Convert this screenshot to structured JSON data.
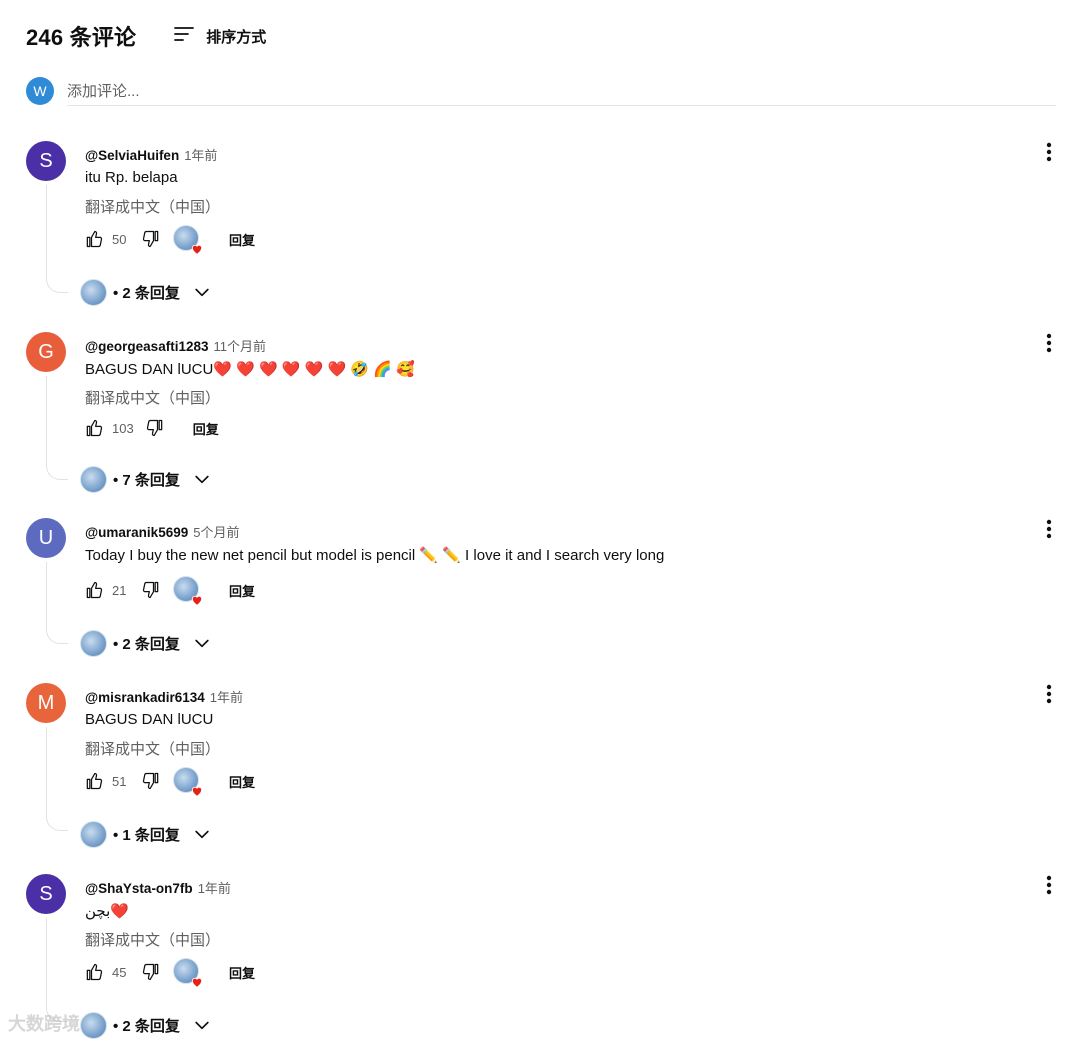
{
  "header": {
    "count": "246 条评论",
    "sort_label": "排序方式"
  },
  "add_comment": {
    "avatar_letter": "W",
    "placeholder": "添加评论..."
  },
  "comments": [
    {
      "letter": "S",
      "avatar_color": "#4a2fa6",
      "author": "@SelviaHuifen",
      "time": "1年前",
      "text": "itu  Rp. belapa",
      "translate": "翻译成中文（中国）",
      "likes": "50",
      "reply": "回复",
      "replies": "• 2 条回复"
    },
    {
      "letter": "G",
      "avatar_color": "#e85d3a",
      "author": "@georgeasafti1283",
      "time": "11个月前",
      "text": "BAGUS DAN lUCU❤️ ❤️ ❤️ ❤️ ❤️ ❤️ 🤣 🌈 🥰",
      "translate": "翻译成中文（中国）",
      "likes": "103",
      "reply": "回复",
      "replies": "• 7 条回复"
    },
    {
      "letter": "U",
      "avatar_color": "#5c6bc0",
      "author": "@umaranik5699",
      "time": "5个月前",
      "text": "Today I buy the new net pencil but model is pencil ✏️ ✏️  I love it and I search very long",
      "likes": "21",
      "reply": "回复",
      "replies": "• 2 条回复"
    },
    {
      "letter": "M",
      "avatar_color": "#e8643a",
      "author": "@misrankadir6134",
      "time": "1年前",
      "text": "BAGUS DAN lUCU",
      "translate": "翻译成中文（中国）",
      "likes": "51",
      "reply": "回复",
      "replies": "• 1 条回复"
    },
    {
      "letter": "S",
      "avatar_color": "#4a2fa6",
      "author": "@ShaYsta-on7fb",
      "time": "1年前",
      "text": "بچن❤️",
      "translate": "翻译成中文（中国）",
      "likes": "45",
      "reply": "回复",
      "replies": "• 2 条回复"
    }
  ],
  "watermark": "大数跨境"
}
